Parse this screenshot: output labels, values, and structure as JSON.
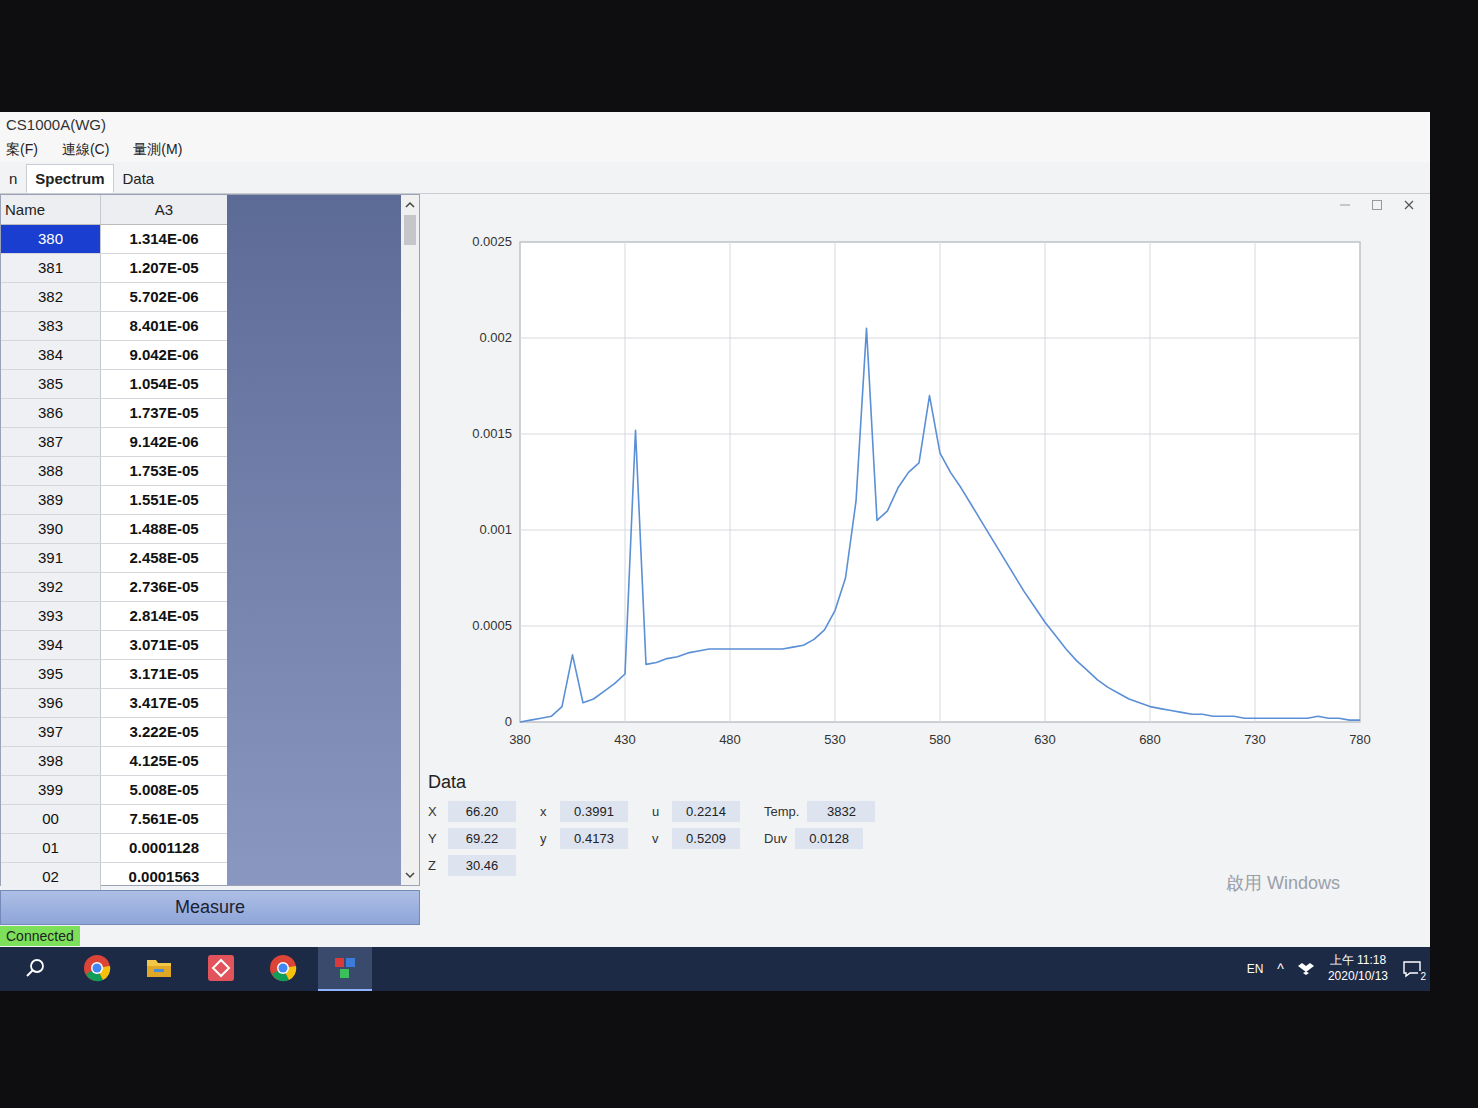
{
  "window": {
    "title": "CS1000A(WG)"
  },
  "menu": [
    "案(F)",
    "連線(C)",
    "量測(M)"
  ],
  "tabs": [
    {
      "label": "n",
      "selected": false
    },
    {
      "label": "Spectrum",
      "selected": true
    },
    {
      "label": "Data",
      "selected": false
    }
  ],
  "table": {
    "columns": [
      "Name",
      "A3"
    ],
    "rows": [
      {
        "name": "380",
        "value": "1.314E-06",
        "selected": true
      },
      {
        "name": "381",
        "value": "1.207E-05",
        "selected": false
      },
      {
        "name": "382",
        "value": "5.702E-06",
        "selected": false
      },
      {
        "name": "383",
        "value": "8.401E-06",
        "selected": false
      },
      {
        "name": "384",
        "value": "9.042E-06",
        "selected": false
      },
      {
        "name": "385",
        "value": "1.054E-05",
        "selected": false
      },
      {
        "name": "386",
        "value": "1.737E-05",
        "selected": false
      },
      {
        "name": "387",
        "value": "9.142E-06",
        "selected": false
      },
      {
        "name": "388",
        "value": "1.753E-05",
        "selected": false
      },
      {
        "name": "389",
        "value": "1.551E-05",
        "selected": false
      },
      {
        "name": "390",
        "value": "1.488E-05",
        "selected": false
      },
      {
        "name": "391",
        "value": "2.458E-05",
        "selected": false
      },
      {
        "name": "392",
        "value": "2.736E-05",
        "selected": false
      },
      {
        "name": "393",
        "value": "2.814E-05",
        "selected": false
      },
      {
        "name": "394",
        "value": "3.071E-05",
        "selected": false
      },
      {
        "name": "395",
        "value": "3.171E-05",
        "selected": false
      },
      {
        "name": "396",
        "value": "3.417E-05",
        "selected": false
      },
      {
        "name": "397",
        "value": "3.222E-05",
        "selected": false
      },
      {
        "name": "398",
        "value": "4.125E-05",
        "selected": false
      },
      {
        "name": "399",
        "value": "5.008E-05",
        "selected": false
      },
      {
        "name": "00",
        "value": "7.561E-05",
        "selected": false
      },
      {
        "name": "01",
        "value": "0.0001128",
        "selected": false
      },
      {
        "name": "02",
        "value": "0.0001563",
        "selected": false
      }
    ]
  },
  "chart": {
    "y_ticks": [
      "0",
      "0.0005",
      "0.001",
      "0.0015",
      "0.002",
      "0.0025"
    ],
    "x_ticks": [
      "380",
      "430",
      "480",
      "530",
      "580",
      "630",
      "680",
      "730",
      "780"
    ],
    "series": [
      {
        "name": "A3",
        "x_start": 380,
        "x_step": 5,
        "values": [
          0.0,
          1e-05,
          2e-05,
          3e-05,
          8e-05,
          0.00035,
          0.0001,
          0.00012,
          0.00016,
          0.0002,
          0.00025,
          0.00152,
          0.0003,
          0.00031,
          0.00033,
          0.00034,
          0.00036,
          0.00037,
          0.00038,
          0.00038,
          0.00038,
          0.00038,
          0.00038,
          0.00038,
          0.00038,
          0.00038,
          0.00039,
          0.0004,
          0.00043,
          0.00048,
          0.00058,
          0.00075,
          0.00115,
          0.00205,
          0.00105,
          0.0011,
          0.00122,
          0.0013,
          0.00135,
          0.0017,
          0.0014,
          0.0013,
          0.00122,
          0.00113,
          0.00104,
          0.00095,
          0.00086,
          0.00077,
          0.00068,
          0.0006,
          0.00052,
          0.00045,
          0.00038,
          0.00032,
          0.00027,
          0.00022,
          0.00018,
          0.00015,
          0.00012,
          0.0001,
          8e-05,
          7e-05,
          6e-05,
          5e-05,
          4e-05,
          4e-05,
          3e-05,
          3e-05,
          3e-05,
          2e-05,
          2e-05,
          2e-05,
          2e-05,
          2e-05,
          2e-05,
          2e-05,
          3e-05,
          2e-05,
          2e-05,
          1e-05,
          1e-05
        ]
      }
    ]
  },
  "data_panel": {
    "title": "Data",
    "columns": [
      [
        {
          "label": "X",
          "value": "66.20"
        },
        {
          "label": "Y",
          "value": "69.22"
        },
        {
          "label": "Z",
          "value": "30.46"
        }
      ],
      [
        {
          "label": "x",
          "value": "0.3991"
        },
        {
          "label": "y",
          "value": "0.4173"
        }
      ],
      [
        {
          "label": "u",
          "value": "0.2214"
        },
        {
          "label": "v",
          "value": "0.5209"
        }
      ],
      [
        {
          "label": "Temp.",
          "value": "3832"
        },
        {
          "label": "Duv",
          "value": "0.0128"
        }
      ]
    ]
  },
  "measure_button": "Measure",
  "status": {
    "text": "Connected",
    "connected": true
  },
  "watermark": "啟用 Windows",
  "taskbar": {
    "apps": [
      {
        "kind": "search",
        "selected": false
      },
      {
        "kind": "chrome",
        "selected": false
      },
      {
        "kind": "folder",
        "selected": false
      },
      {
        "kind": "red-app",
        "selected": false
      },
      {
        "kind": "chrome",
        "selected": false
      },
      {
        "kind": "color-app",
        "selected": true
      }
    ],
    "language": "EN",
    "tray_arrow": "^",
    "time": "上午 11:18",
    "date": "2020/10/13",
    "notifications": "2"
  }
}
